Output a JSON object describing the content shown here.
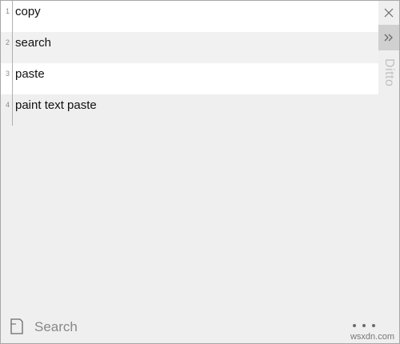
{
  "app": {
    "title": "Ditto"
  },
  "clips": [
    {
      "number": "1",
      "text": "copy"
    },
    {
      "number": "2",
      "text": "search"
    },
    {
      "number": "3",
      "text": "paste"
    },
    {
      "number": "4",
      "text": "paint text paste"
    }
  ],
  "sidebar": {
    "close_icon": "close-icon",
    "expand_icon": "double-chevron-right-icon"
  },
  "search": {
    "placeholder": "Search",
    "value": "",
    "icon": "notepad-icon"
  },
  "menu": {
    "icon": "more-dots-icon"
  },
  "watermark": "wsxdn.com",
  "colors": {
    "background": "#efefef",
    "row_alt": "#ffffff",
    "side_title": "#c0c0c0",
    "expand_button": "#d0d0d0"
  }
}
